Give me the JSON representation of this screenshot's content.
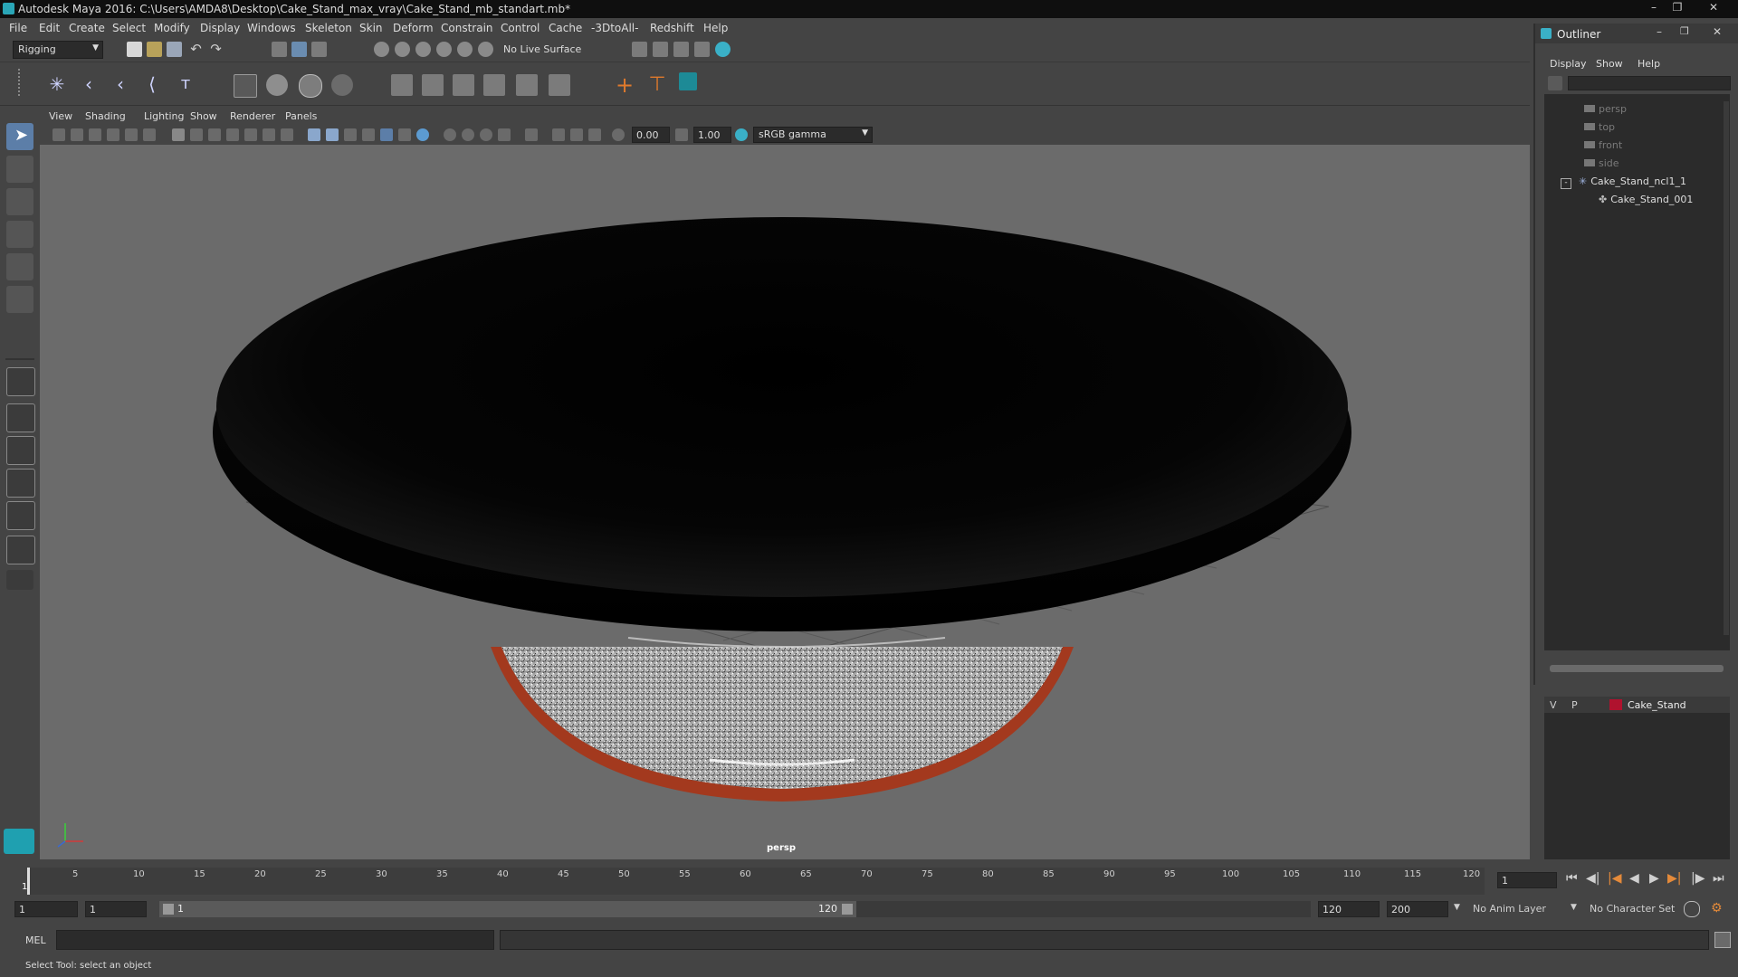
{
  "window_title": "Autodesk Maya 2016: C:\\Users\\AMDA8\\Desktop\\Cake_Stand_max_vray\\Cake_Stand_mb_standart.mb*",
  "menu": [
    "File",
    "Edit",
    "Create",
    "Select",
    "Modify",
    "Display",
    "Windows",
    "Skeleton",
    "Skin",
    "Deform",
    "Constrain",
    "Control",
    "Cache",
    "-3DtoAll-",
    "Redshift",
    "Help"
  ],
  "status_line": {
    "mode": "Rigging",
    "live_surface": "No Live Surface"
  },
  "panel_menu": [
    "View",
    "Shading",
    "Lighting",
    "Show",
    "Renderer",
    "Panels"
  ],
  "view_toolbar": {
    "value1": "0.00",
    "value2": "1.00",
    "color_space": "sRGB gamma"
  },
  "viewport": {
    "camera_label": "persp",
    "background": "#6b6b6b"
  },
  "timeline": {
    "ticks": [
      "1",
      "5",
      "10",
      "15",
      "20",
      "25",
      "30",
      "35",
      "40",
      "45",
      "50",
      "55",
      "60",
      "65",
      "70",
      "75",
      "80",
      "85",
      "90",
      "95",
      "100",
      "105",
      "110",
      "115",
      "120"
    ],
    "current_frame": "1"
  },
  "range": {
    "start": "1",
    "start_inner": "1",
    "slider_start": "1",
    "slider_end": "120",
    "end_inner": "120",
    "end": "200",
    "anim_layer": "No Anim Layer",
    "char_set": "No Character Set"
  },
  "command_line": {
    "label": "MEL"
  },
  "help_line": "Select Tool: select an object",
  "outliner": {
    "title": "Outliner",
    "menus": [
      "Display",
      "Show",
      "Help"
    ],
    "items": [
      {
        "label": "persp",
        "dim": true
      },
      {
        "label": "top",
        "dim": true
      },
      {
        "label": "front",
        "dim": true
      },
      {
        "label": "side",
        "dim": true
      },
      {
        "label": "Cake_Stand_ncl1_1",
        "dim": false
      },
      {
        "label": "Cake_Stand_001",
        "dim": false
      }
    ]
  },
  "layers": {
    "v": "V",
    "p": "P",
    "layer_name": "Cake_Stand",
    "layer_color": "#b0122e"
  },
  "colors": {
    "accent": "#56c1cc",
    "stand_base": "#a3391e",
    "plate": "#050505"
  }
}
